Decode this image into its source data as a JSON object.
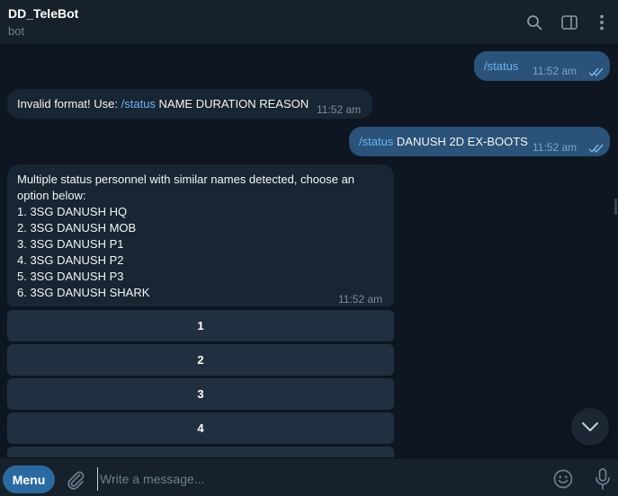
{
  "header": {
    "title": "DD_TeleBot",
    "subtitle": "bot",
    "icons": [
      "search-icon",
      "sidebar-toggle-icon",
      "more-vertical-icon"
    ]
  },
  "messages": [
    {
      "direction": "out",
      "command": "/status",
      "text": "",
      "time": "11:52 am",
      "read": true
    },
    {
      "direction": "in",
      "prefix": "Invalid format! Use: ",
      "command": "/status",
      "text": " NAME DURATION REASON",
      "time": "11:52 am"
    },
    {
      "direction": "out",
      "command": "/status",
      "text": " DANUSH 2D EX-BOOTS",
      "time": "11:52 am",
      "read": true
    },
    {
      "direction": "in",
      "lines": [
        "Multiple status personnel with similar names detected, choose an",
        "option below:",
        "1. 3SG DANUSH HQ",
        "2. 3SG DANUSH MOB",
        "3. 3SG DANUSH P1",
        "4. 3SG DANUSH P2",
        "5. 3SG DANUSH P3",
        "6. 3SG DANUSH SHARK"
      ],
      "time": "11:52 am"
    }
  ],
  "keyboard": {
    "buttons": [
      "1",
      "2",
      "3",
      "4"
    ]
  },
  "composer": {
    "menu_label": "Menu",
    "placeholder": "Write a message...",
    "value": ""
  },
  "colors": {
    "background": "#0e1621",
    "header": "#17212b",
    "outgoing_bubble": "#2b5278",
    "incoming_bubble": "#182533",
    "command_link": "#6ab3f3",
    "menu_button": "#2b6aa0"
  }
}
